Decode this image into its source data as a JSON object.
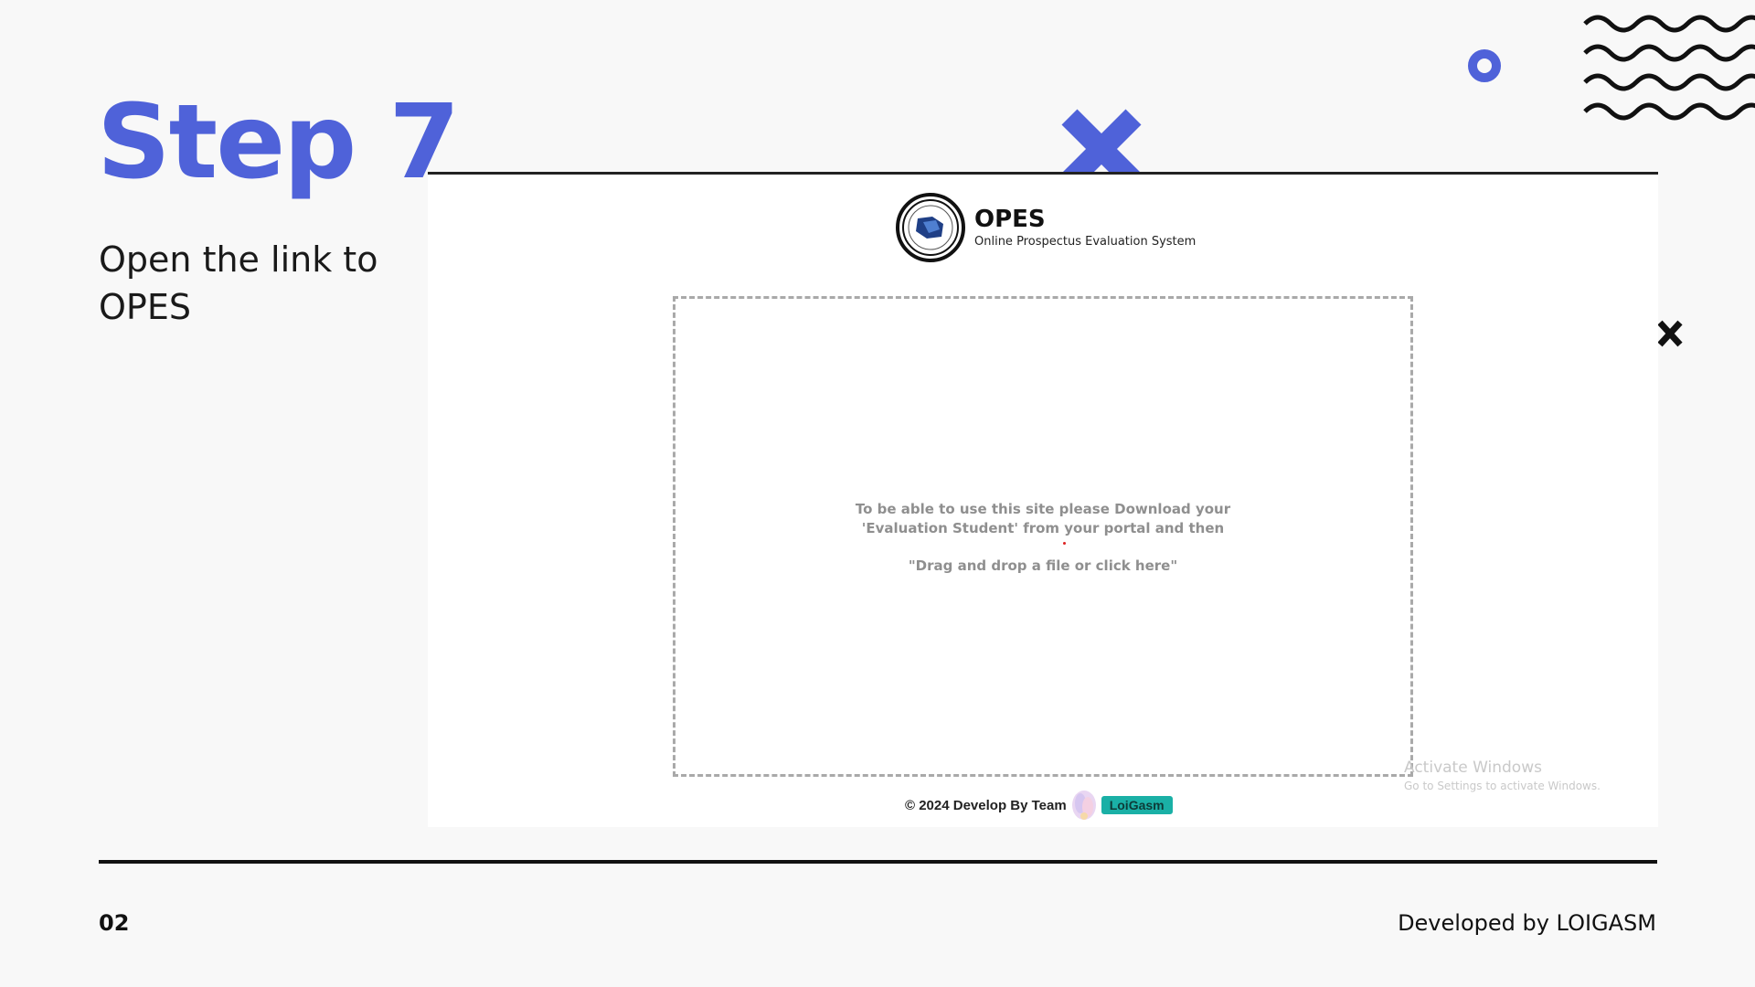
{
  "slide": {
    "title": "Step 7",
    "description": "Open the link to OPES",
    "page_number": "02",
    "credit": "Developed by LOIGASM"
  },
  "screenshot": {
    "app_name": "OPES",
    "app_subtitle": "Online Prospectus Evaluation System",
    "dropzone": {
      "line1": "To be able to use this site please Download your",
      "line2": "'Evaluation Student' from your portal and then",
      "line3": "\"Drag and drop a file or click here\""
    },
    "footer": {
      "copyright": "© 2024 Develop By  Team",
      "team_name": "LoiGasm"
    },
    "watermark": {
      "title": "Activate Windows",
      "subtitle": "Go to Settings to activate Windows."
    }
  },
  "colors": {
    "accent": "#4f62d9",
    "background": "#f8f8f8",
    "badge": "#1ab0a6"
  },
  "icons": {
    "logo": "opes-seal-icon",
    "decorations": [
      "blue-x-icon",
      "ring-icon",
      "waves-icon",
      "black-x-icon"
    ]
  }
}
